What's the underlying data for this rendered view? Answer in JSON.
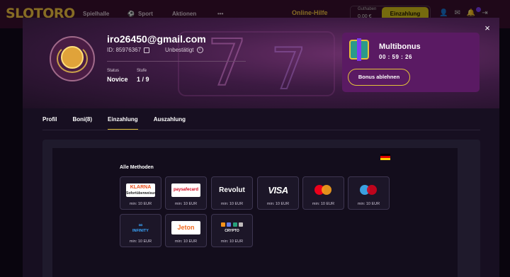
{
  "site": {
    "logo": "SLOTORO",
    "nav": [
      "Spielhalle",
      "Sport",
      "Aktionen",
      "•••"
    ],
    "online_help": "Online-Hilfe",
    "balance_label": "Guthaben",
    "balance_value": "0,00 €",
    "deposit_button": "Einzahlung"
  },
  "profile": {
    "close_label": "×",
    "email": "iro26450@gmail.com",
    "id_text": "ID: 85976367",
    "verification": "Unbestätigt",
    "status_label": "Status",
    "status_value": "Novice",
    "level_label": "Stufe",
    "level_value": "1 / 9"
  },
  "bonus": {
    "title": "Multibonus",
    "timer": "00 : 59 : 26",
    "decline_button": "Bonus ablehnen"
  },
  "tabs": [
    {
      "label": "Profil",
      "active": false
    },
    {
      "label": "Boni(8)",
      "active": false
    },
    {
      "label": "Einzahlung",
      "active": true
    },
    {
      "label": "Auszahlung",
      "active": false
    }
  ],
  "deposit": {
    "section_title": "Alle Methoden",
    "country_flag": "de-flag",
    "methods": [
      {
        "name": "Sofortüberweisung",
        "min": "min: 10 EUR",
        "logo_text": "Sofortüberweisung"
      },
      {
        "name": "paysafecard",
        "min": "min: 10 EUR",
        "logo_text": "paysafecard"
      },
      {
        "name": "Revolut",
        "min": "min: 10 EUR",
        "logo_text": "Revolut"
      },
      {
        "name": "VISA",
        "min": "min: 10 EUR",
        "logo_text": "VISA"
      },
      {
        "name": "Mastercard",
        "min": "min: 10 EUR",
        "logo_text": "mastercard"
      },
      {
        "name": "Maestro",
        "min": "min: 10 EUR",
        "logo_text": ""
      },
      {
        "name": "Nuvei",
        "min": "min: 10 EUR",
        "logo_text": "INFINITY"
      },
      {
        "name": "Jeton",
        "min": "min: 10 EUR",
        "logo_text": "Jeton"
      },
      {
        "name": "Crypto",
        "min": "min: 10 EUR",
        "logo_text": "CRYPTO"
      }
    ]
  },
  "colors": {
    "accent": "#e3c23a",
    "bonus_card": "#5a1a63",
    "modal_bg": "#170f21"
  }
}
